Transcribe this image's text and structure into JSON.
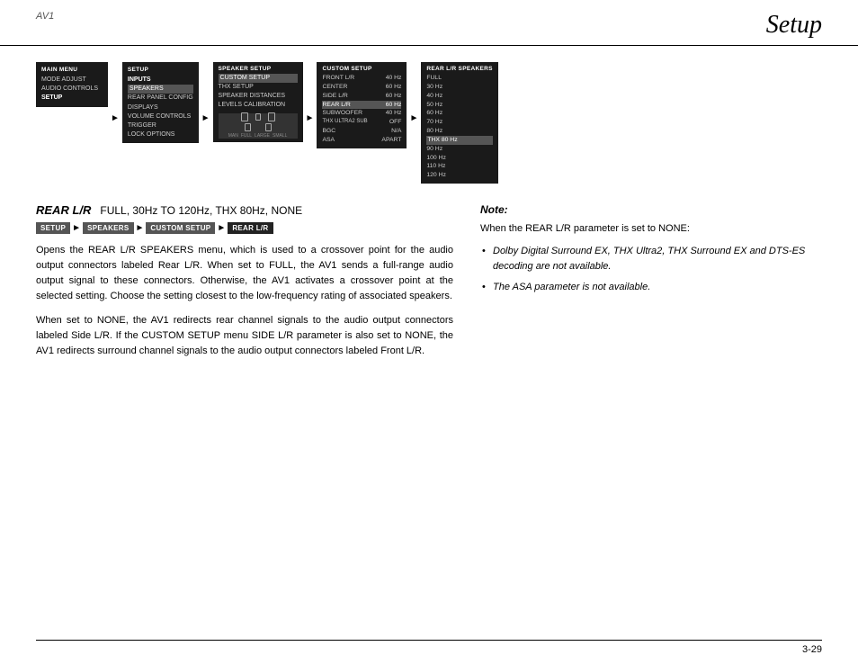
{
  "header": {
    "left": "AV1",
    "right": "Setup"
  },
  "footer": {
    "page": "3-29"
  },
  "menu": {
    "main_menu": {
      "title": "MAIN MENU",
      "items": [
        "MODE ADJUST",
        "AUDIO CONTROLS",
        "SETUP"
      ],
      "selected": "SETUP"
    },
    "setup": {
      "title": "SETUP",
      "items": [
        "INPUTS",
        "SPEAKERS",
        "REAR PANEL CONFIG",
        "DISPLAYS",
        "VOLUME CONTROLS",
        "TRIGGER",
        "LOCK OPTIONS"
      ],
      "selected": "SPEAKERS"
    },
    "speaker_setup": {
      "title": "SPEAKER SETUP",
      "items": [
        "CUSTOM SETUP",
        "THX SETUP",
        "SPEAKER DISTANCES",
        "LEVELS CALIBRATION"
      ],
      "selected": "CUSTOM SETUP"
    },
    "custom_setup": {
      "title": "CUSTOM SETUP",
      "rows": [
        {
          "label": "FRONT L/R",
          "val": "40 Hz"
        },
        {
          "label": "CENTER",
          "val": "60 Hz"
        },
        {
          "label": "SIDE L/R",
          "val": "60 Hz"
        },
        {
          "label": "REAR L/R",
          "val": "60 Hz",
          "selected": true
        },
        {
          "label": "SUBWOOFER",
          "val": "40 Hz"
        },
        {
          "label": "THX ULTRA2 SUB",
          "val": "OFF"
        },
        {
          "label": "BGC",
          "val": "N/A"
        },
        {
          "label": "ASA",
          "val": "APART"
        }
      ]
    },
    "rear_lr_speakers": {
      "title": "REAR L/R SPEAKERS",
      "items": [
        "FULL",
        "30 Hz",
        "40 Hz",
        "50 Hz",
        "60 Hz",
        "70 Hz",
        "80 Hz",
        "THX 80 Hz",
        "90 Hz",
        "100 Hz",
        "110 Hz",
        "120 Hz"
      ],
      "selected": "THX 80 Hz"
    }
  },
  "section": {
    "title": "REAR L/R",
    "values": "FULL, 30Hz TO 120Hz, THX 80Hz, NONE"
  },
  "breadcrumb": {
    "items": [
      "SETUP",
      "SPEAKERS",
      "CUSTOM SETUP",
      "REAR L/R"
    ]
  },
  "body_paragraphs": [
    "Opens the REAR L/R SPEAKERS menu, which is used to a crossover point for the audio output connectors labeled Rear L/R. When set to FULL, the AV1 sends a full-range audio output signal to these connectors. Otherwise, the AV1 activates a crossover point at the selected setting. Choose the setting closest to the low-frequency rating of associated speakers.",
    "When set to NONE, the AV1 redirects rear channel signals to the audio output connectors labeled Side L/R. If the CUSTOM SETUP menu SIDE L/R parameter is also set to NONE, the AV1 redirects surround channel signals to the audio output connectors labeled Front L/R."
  ],
  "note": {
    "title": "Note:",
    "intro": "When the REAR L/R parameter is set to NONE:",
    "items": [
      "Dolby Digital Surround EX, THX Ultra2, THX Surround EX and DTS-ES decoding are not available.",
      "The ASA parameter is not available."
    ]
  }
}
